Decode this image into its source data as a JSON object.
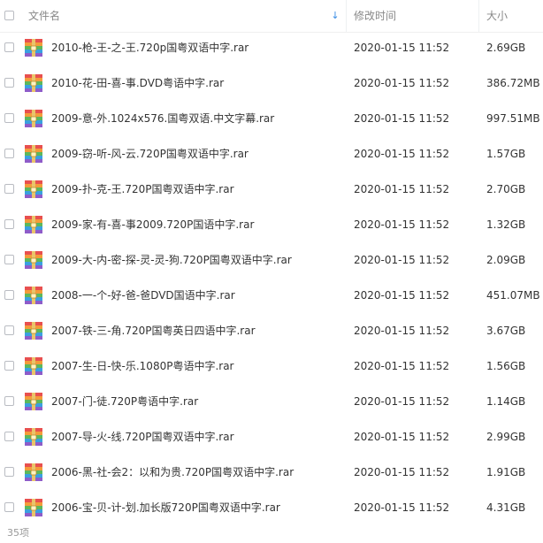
{
  "header": {
    "name_label": "文件名",
    "sort_arrow": "↓",
    "time_label": "修改时间",
    "size_label": "大小"
  },
  "files": [
    {
      "name": "2010-枪-王-之-王.720p国粤双语中字.rar",
      "time": "2020-01-15 11:52",
      "size": "2.69GB"
    },
    {
      "name": "2010-花-田-喜-事.DVD粤语中字.rar",
      "time": "2020-01-15 11:52",
      "size": "386.72MB"
    },
    {
      "name": "2009-意-外.1024x576.国粤双语.中文字幕.rar",
      "time": "2020-01-15 11:52",
      "size": "997.51MB"
    },
    {
      "name": "2009-窃-听-风-云.720P国粤双语中字.rar",
      "time": "2020-01-15 11:52",
      "size": "1.57GB"
    },
    {
      "name": "2009-扑-克-王.720P国粤双语中字.rar",
      "time": "2020-01-15 11:52",
      "size": "2.70GB"
    },
    {
      "name": "2009-家-有-喜-事2009.720P国语中字.rar",
      "time": "2020-01-15 11:52",
      "size": "1.32GB"
    },
    {
      "name": "2009-大-内-密-探-灵-灵-狗.720P国粤双语中字.rar",
      "time": "2020-01-15 11:52",
      "size": "2.09GB"
    },
    {
      "name": "2008-一-个-好-爸-爸DVD国语中字.rar",
      "time": "2020-01-15 11:52",
      "size": "451.07MB"
    },
    {
      "name": "2007-铁-三-角.720P国粤英日四语中字.rar",
      "time": "2020-01-15 11:52",
      "size": "3.67GB"
    },
    {
      "name": "2007-生-日-快-乐.1080P粤语中字.rar",
      "time": "2020-01-15 11:52",
      "size": "1.56GB"
    },
    {
      "name": "2007-门-徒.720P粤语中字.rar",
      "time": "2020-01-15 11:52",
      "size": "1.14GB"
    },
    {
      "name": "2007-导-火-线.720P国粤双语中字.rar",
      "time": "2020-01-15 11:52",
      "size": "2.99GB"
    },
    {
      "name": "2006-黑-社-会2：以和为贵.720P国粤双语中字.rar",
      "time": "2020-01-15 11:52",
      "size": "1.91GB"
    },
    {
      "name": "2006-宝-贝-计-划.加长版720P国粤双语中字.rar",
      "time": "2020-01-15 11:52",
      "size": "4.31GB"
    }
  ],
  "file_icon": "archive-icon",
  "footer": {
    "count": "35项"
  }
}
